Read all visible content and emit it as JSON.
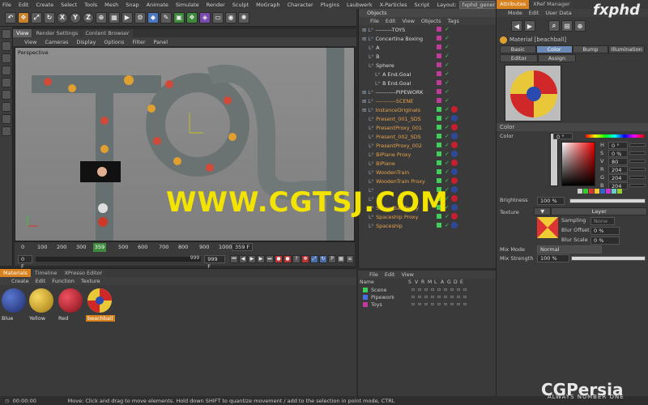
{
  "menubar": {
    "items": [
      "File",
      "Edit",
      "Create",
      "Select",
      "Tools",
      "Mesh",
      "Snap",
      "Animate",
      "Simulate",
      "Render",
      "Sculpt",
      "MoGraph",
      "Character",
      "Plugins",
      "Laubwerk",
      "X-Particles",
      "Script"
    ],
    "layout_label": "Layout:",
    "layout_value": "fxphd_general (User)"
  },
  "toolbar": {
    "icons": [
      "undo-icon",
      "move-icon",
      "scale-icon",
      "rotate-icon",
      "x-axis-icon",
      "y-axis-icon",
      "z-axis-icon",
      "world-coord-icon",
      "cube-icon",
      "pen-icon",
      "subdivide-icon",
      "array-icon",
      "deformer-icon",
      "floor-icon",
      "camera-icon",
      "light-icon"
    ],
    "axis_labels": [
      "X",
      "Y",
      "Z"
    ]
  },
  "viewport": {
    "tabs": [
      "View",
      "Render Settings",
      "Content Browser"
    ],
    "menu": [
      "View",
      "Cameras",
      "Display",
      "Options",
      "Filter",
      "Panel"
    ],
    "label": "Perspective"
  },
  "timeline": {
    "ticks": [
      "0",
      "100",
      "200",
      "300",
      "500",
      "600",
      "700",
      "800",
      "900",
      "1000"
    ],
    "current": "359",
    "field1": "359 F",
    "field2": "999 F",
    "start": "0 F",
    "end": "999"
  },
  "objects": {
    "title": "Objects",
    "menu": [
      "File",
      "Edit",
      "View",
      "Objects",
      "Tags"
    ],
    "rows": [
      {
        "name": "---------TOYS",
        "indent": 0,
        "orange": false
      },
      {
        "name": "Concertina Boxing",
        "indent": 0,
        "orange": false
      },
      {
        "name": "A",
        "indent": 1,
        "orange": false
      },
      {
        "name": "B",
        "indent": 1,
        "orange": false
      },
      {
        "name": "Sphere",
        "indent": 1,
        "orange": false
      },
      {
        "name": "A End.Goal",
        "indent": 2,
        "orange": false
      },
      {
        "name": "B End.Goal",
        "indent": 2,
        "orange": false
      },
      {
        "name": "-----------PIPEWORK",
        "indent": 0,
        "orange": false
      },
      {
        "name": "-----------SCENE",
        "indent": 0,
        "orange": true
      },
      {
        "name": "InstanceOriginals",
        "indent": 0,
        "orange": true
      },
      {
        "name": "Present_001_SDS",
        "indent": 1,
        "orange": true
      },
      {
        "name": "PresentProxy_001",
        "indent": 1,
        "orange": true
      },
      {
        "name": "Present_002_SDS",
        "indent": 1,
        "orange": true
      },
      {
        "name": "PresentProxy_002",
        "indent": 1,
        "orange": true
      },
      {
        "name": "BiPlane Proxy",
        "indent": 1,
        "orange": true
      },
      {
        "name": "BiPlane",
        "indent": 1,
        "orange": true
      },
      {
        "name": "WoodenTrain",
        "indent": 1,
        "orange": true
      },
      {
        "name": "WoodenTrain Proxy",
        "indent": 1,
        "orange": true
      },
      {
        "name": "",
        "indent": 1,
        "orange": true
      },
      {
        "name": "",
        "indent": 1,
        "orange": true
      },
      {
        "name": "SoccerBall Proxy",
        "indent": 1,
        "orange": true
      },
      {
        "name": "Spaceship Proxy",
        "indent": 1,
        "orange": true
      },
      {
        "name": "Spaceship",
        "indent": 1,
        "orange": true
      }
    ]
  },
  "attributes": {
    "tabs": [
      "Attributes",
      "XRef Manager"
    ],
    "menu": [
      "Mode",
      "Edit",
      "User Data"
    ],
    "material_name": "Material [beachball]",
    "channel_tabs_row1": [
      "Basic",
      "Color",
      "Bump",
      "Illumination"
    ],
    "channel_tabs_row2": [
      "Editor",
      "Assign"
    ],
    "section": "Color",
    "color_label": "Color",
    "hsv": [
      {
        "k": "H",
        "v": "0 °"
      },
      {
        "k": "S",
        "v": "0 %"
      },
      {
        "k": "V",
        "v": "80 %"
      }
    ],
    "rgb": [
      {
        "k": "R",
        "v": "204"
      },
      {
        "k": "G",
        "v": "204"
      },
      {
        "k": "B",
        "v": "204"
      }
    ],
    "brightness_label": "Brightness",
    "brightness_value": "100 %",
    "texture_label": "Texture",
    "layer_btn": "Layer",
    "sampling_label": "Sampling",
    "sampling_value": "None",
    "blur_offset_label": "Blur Offset",
    "blur_offset_value": "0 %",
    "blur_scale_label": "Blur Scale",
    "blur_scale_value": "0 %",
    "mix_mode_label": "Mix Mode",
    "mix_mode_value": "Normal",
    "mix_strength_label": "Mix Strength",
    "mix_strength_value": "100 %"
  },
  "materials": {
    "tabs": [
      "Materials",
      "Timeline",
      "XPresso Editor"
    ],
    "menu": [
      "Create",
      "Edit",
      "Function",
      "Texture"
    ],
    "items": [
      {
        "label": "Blue",
        "color": "#2d4a9a"
      },
      {
        "label": "Yellow",
        "color": "#e0b020"
      },
      {
        "label": "Red",
        "color": "#c81e2e"
      },
      {
        "label": "beachball",
        "color": "#e8c838"
      }
    ]
  },
  "layers": {
    "menu": [
      "File",
      "Edit",
      "View"
    ],
    "header_name": "Name",
    "cols": [
      "S",
      "V",
      "R",
      "M",
      "L",
      "A",
      "G",
      "D",
      "E"
    ],
    "rows": [
      {
        "name": "Scene",
        "color": "#3fcf5a"
      },
      {
        "name": "Pipework",
        "color": "#4a6ee0"
      },
      {
        "name": "Toys",
        "color": "#c23a9a"
      }
    ]
  },
  "status": {
    "time": "00:00:00",
    "text": "Move: Click and drag to move elements. Hold down SHIFT to quantize movement / add to the selection in point mode, CTRL"
  },
  "watermarks": {
    "main": "WWW.CGTSJ.COM",
    "fxphd": "fxphd",
    "cgpersia": "CGPersia",
    "cgpersia_sub": "ALWAYS NUMBER ONE"
  }
}
